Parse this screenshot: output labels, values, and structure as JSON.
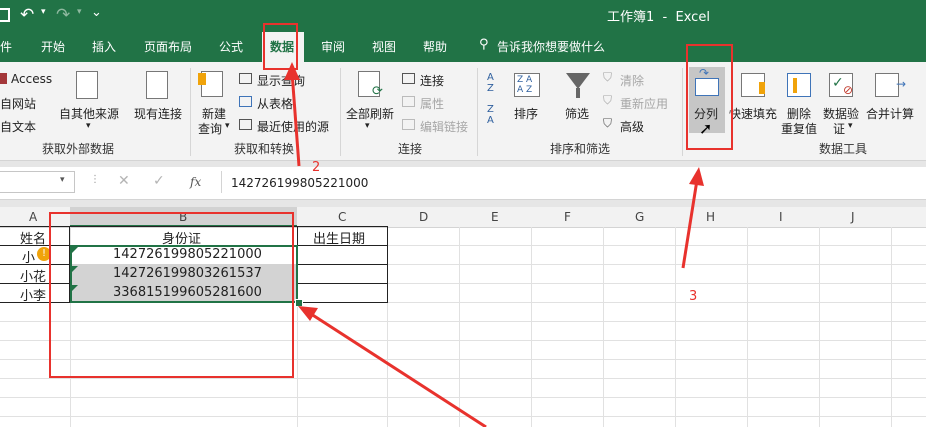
{
  "titlebar": {
    "undo": "↶",
    "redo": "↷",
    "customize": "⌄",
    "title": "工作簿1  -  Excel"
  },
  "menu": {
    "items": [
      "件",
      "开始",
      "插入",
      "页面布局",
      "公式",
      "数据",
      "审阅",
      "视图",
      "帮助"
    ],
    "tellme": "告诉我你想要做什么"
  },
  "ribbon": {
    "get_external": {
      "access": "Access",
      "web": "自网站",
      "text": "自文本",
      "other": "自其他来源",
      "existing": "现有连接",
      "label": "获取外部数据"
    },
    "get_transform": {
      "new_query_1": "新建",
      "new_query_2": "查询",
      "show_queries": "显示查询",
      "from_table": "从表格",
      "recent": "最近使用的源",
      "label": "获取和转换"
    },
    "connections": {
      "refresh_all": "全部刷新",
      "connections": "连接",
      "properties": "属性",
      "edit_links": "编辑链接",
      "label": "连接"
    },
    "sort_filter": {
      "sort": "排序",
      "filter": "筛选",
      "clear": "清除",
      "reapply": "重新应用",
      "advanced": "高级",
      "label": "排序和筛选"
    },
    "data_tools": {
      "text_to_columns": "分列",
      "flash_fill": "快速填充",
      "remove_dup_1": "删除",
      "remove_dup_2": "重复值",
      "validation_1": "数据验",
      "validation_2": "证",
      "consolidate": "合并计算",
      "label": "数据工具"
    }
  },
  "formula_bar": {
    "fx": "fx",
    "value": "142726199805221000"
  },
  "columns": [
    "A",
    "B",
    "C",
    "D",
    "E",
    "F",
    "G",
    "H",
    "I",
    "J"
  ],
  "rows": [
    {
      "a": "姓名",
      "b": "身份证",
      "c": "出生日期"
    },
    {
      "a": "小",
      "b": "142726199805221000",
      "c": ""
    },
    {
      "a": "小花",
      "b": "142726199803261537",
      "c": ""
    },
    {
      "a": "小李",
      "b": "336815199605281600",
      "c": ""
    }
  ],
  "annotations": {
    "n2": "2",
    "n3": "3"
  },
  "colors": {
    "excel_green": "#217346",
    "annotation_red": "#e8322d",
    "selection": "#d3d3d3"
  }
}
